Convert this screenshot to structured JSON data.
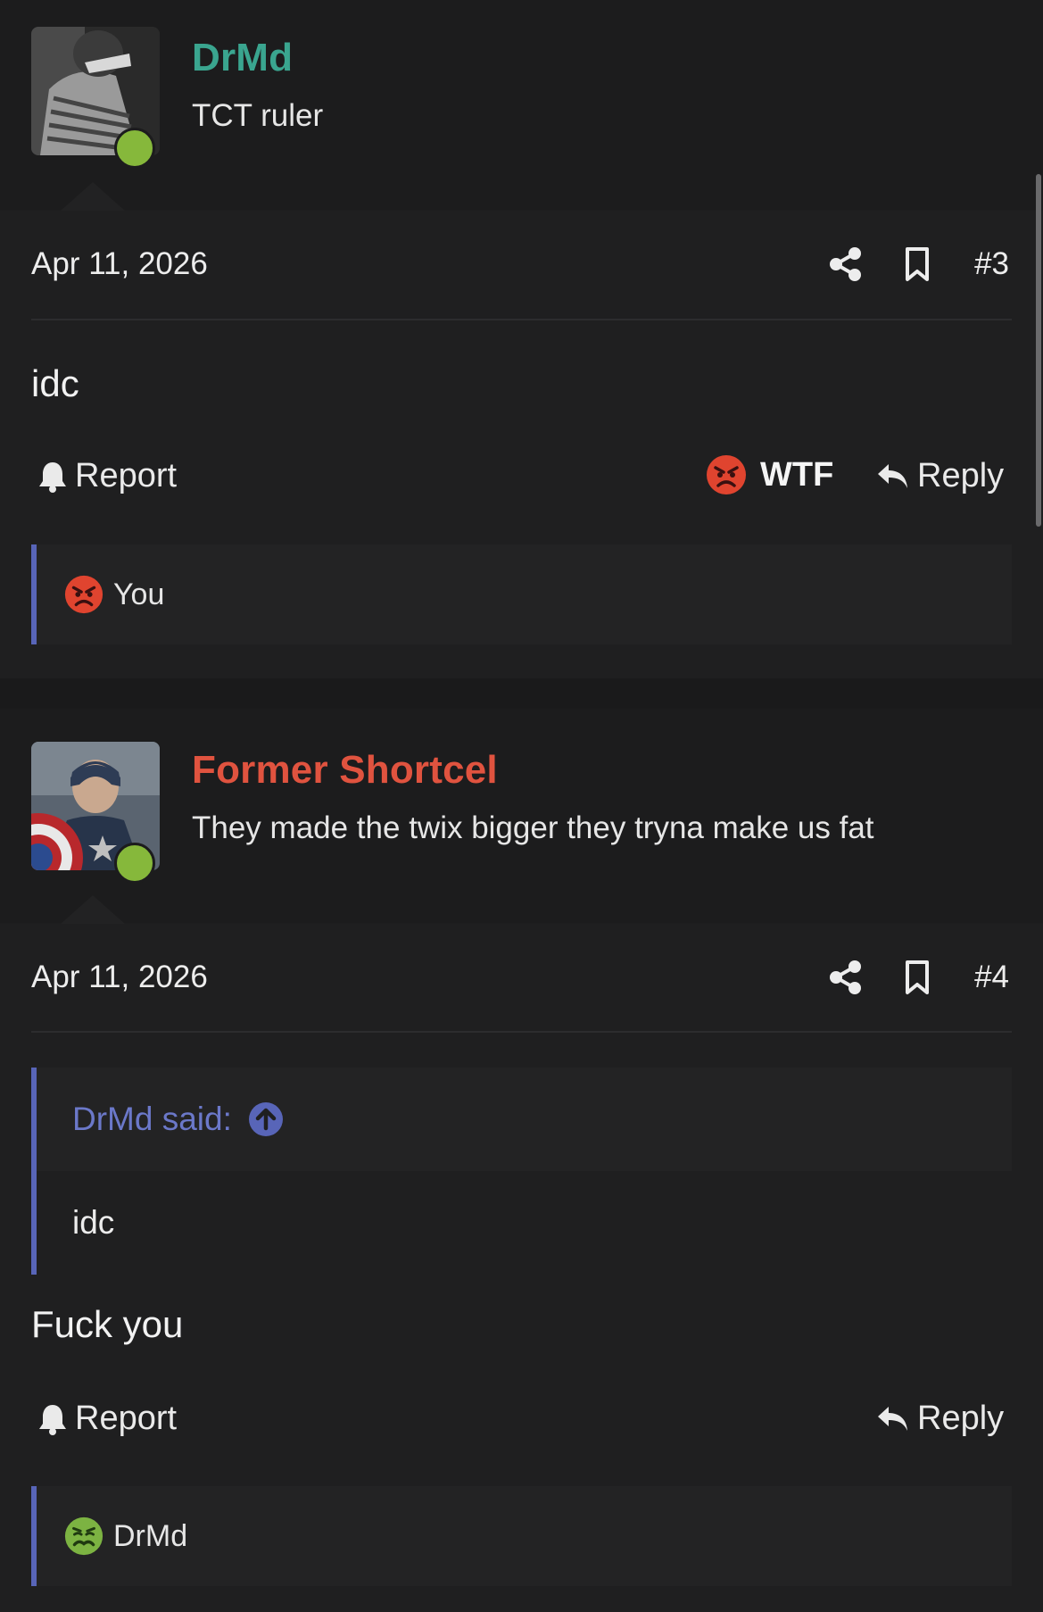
{
  "posts": [
    {
      "username": "DrMd",
      "username_color": "#3aa58f",
      "user_title": "TCT ruler",
      "date": "Apr 11, 2026",
      "post_number": "#3",
      "body": "idc",
      "report_label": "Report",
      "reaction_button": {
        "emoji": "angry-face-icon",
        "label": "WTF"
      },
      "reply_label": "Reply",
      "reactions_summary": {
        "emoji": "angry-face-icon",
        "text": "You"
      }
    },
    {
      "username": "Former Shortcel",
      "username_color": "#e0533f",
      "user_title": "They made the twix bigger they tryna make us fat",
      "date": "Apr 11, 2026",
      "post_number": "#4",
      "quote": {
        "author": "DrMd said:",
        "text": "idc"
      },
      "body": "Fuck you",
      "report_label": "Report",
      "reply_label": "Reply",
      "reactions_summary": {
        "emoji": "nauseated-face-icon",
        "text": "DrMd"
      }
    }
  ],
  "colors": {
    "background": "#1e1e1f",
    "accent_quote": "#5865b8",
    "online": "#86b83b"
  }
}
